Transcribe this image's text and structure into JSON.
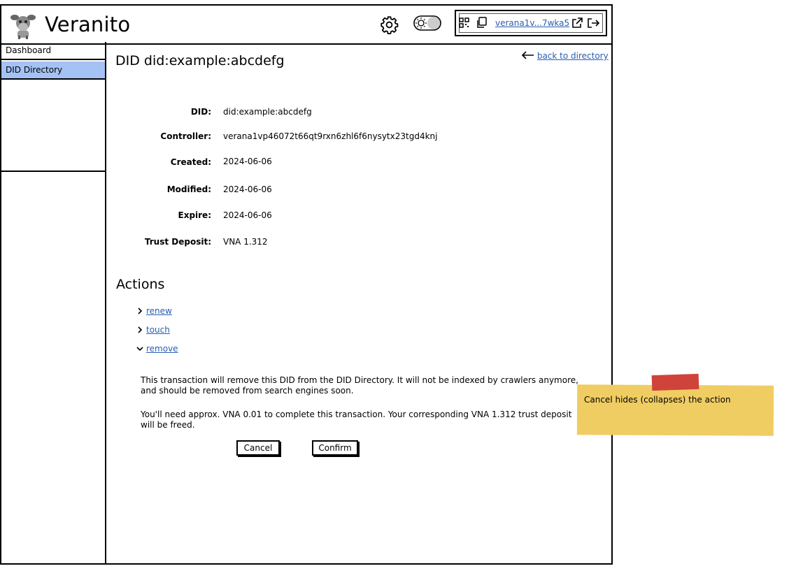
{
  "header": {
    "app_title": "Veranito",
    "wallet_address": "verana1v...7wka5",
    "icons": [
      "gear-icon",
      "theme-toggle-icon",
      "qr-code-icon",
      "copy-icon",
      "external-link-icon",
      "logout-icon"
    ]
  },
  "sidebar": {
    "items": [
      {
        "label": "Dashboard",
        "active": false
      },
      {
        "label": "DID Directory",
        "active": true
      }
    ],
    "active_color": "#a4c2f4"
  },
  "main": {
    "title": "DID did:example:abcdefg",
    "back_link": "back to directory",
    "fields": [
      {
        "label": "DID:",
        "value": "did:example:abcdefg"
      },
      {
        "label": "Controller:",
        "value": "verana1vp46072t66qt9rxn6zhl6f6nysytx23tgd4knj"
      },
      {
        "label": "Created:",
        "value": "2024-06-06"
      },
      {
        "label": "Modified:",
        "value": "2024-06-06"
      },
      {
        "label": "Expire:",
        "value": "2024-06-06"
      },
      {
        "label": "Trust Deposit:",
        "value": "VNA 1.312"
      }
    ],
    "actions_heading": "Actions",
    "actions": [
      {
        "label": "renew",
        "expanded": false
      },
      {
        "label": "touch",
        "expanded": false
      },
      {
        "label": "remove",
        "expanded": true
      }
    ],
    "remove_panel": {
      "paragraph_1": "This transaction will remove this DID from the DID Directory. It will not be indexed by crawlers anymore, and should be removed from search engines soon.",
      "paragraph_2": "You'll need approx. VNA 0.01 to complete this transaction. Your corresponding VNA 1.312 trust deposit will be freed.",
      "cancel_label": "Cancel",
      "confirm_label": "Confirm"
    }
  },
  "sticky_note": {
    "text": "Cancel hides (collapses) the action",
    "color": "#f0cd62",
    "tape_color": "#d0433a"
  },
  "link_color": "#2a5db0"
}
